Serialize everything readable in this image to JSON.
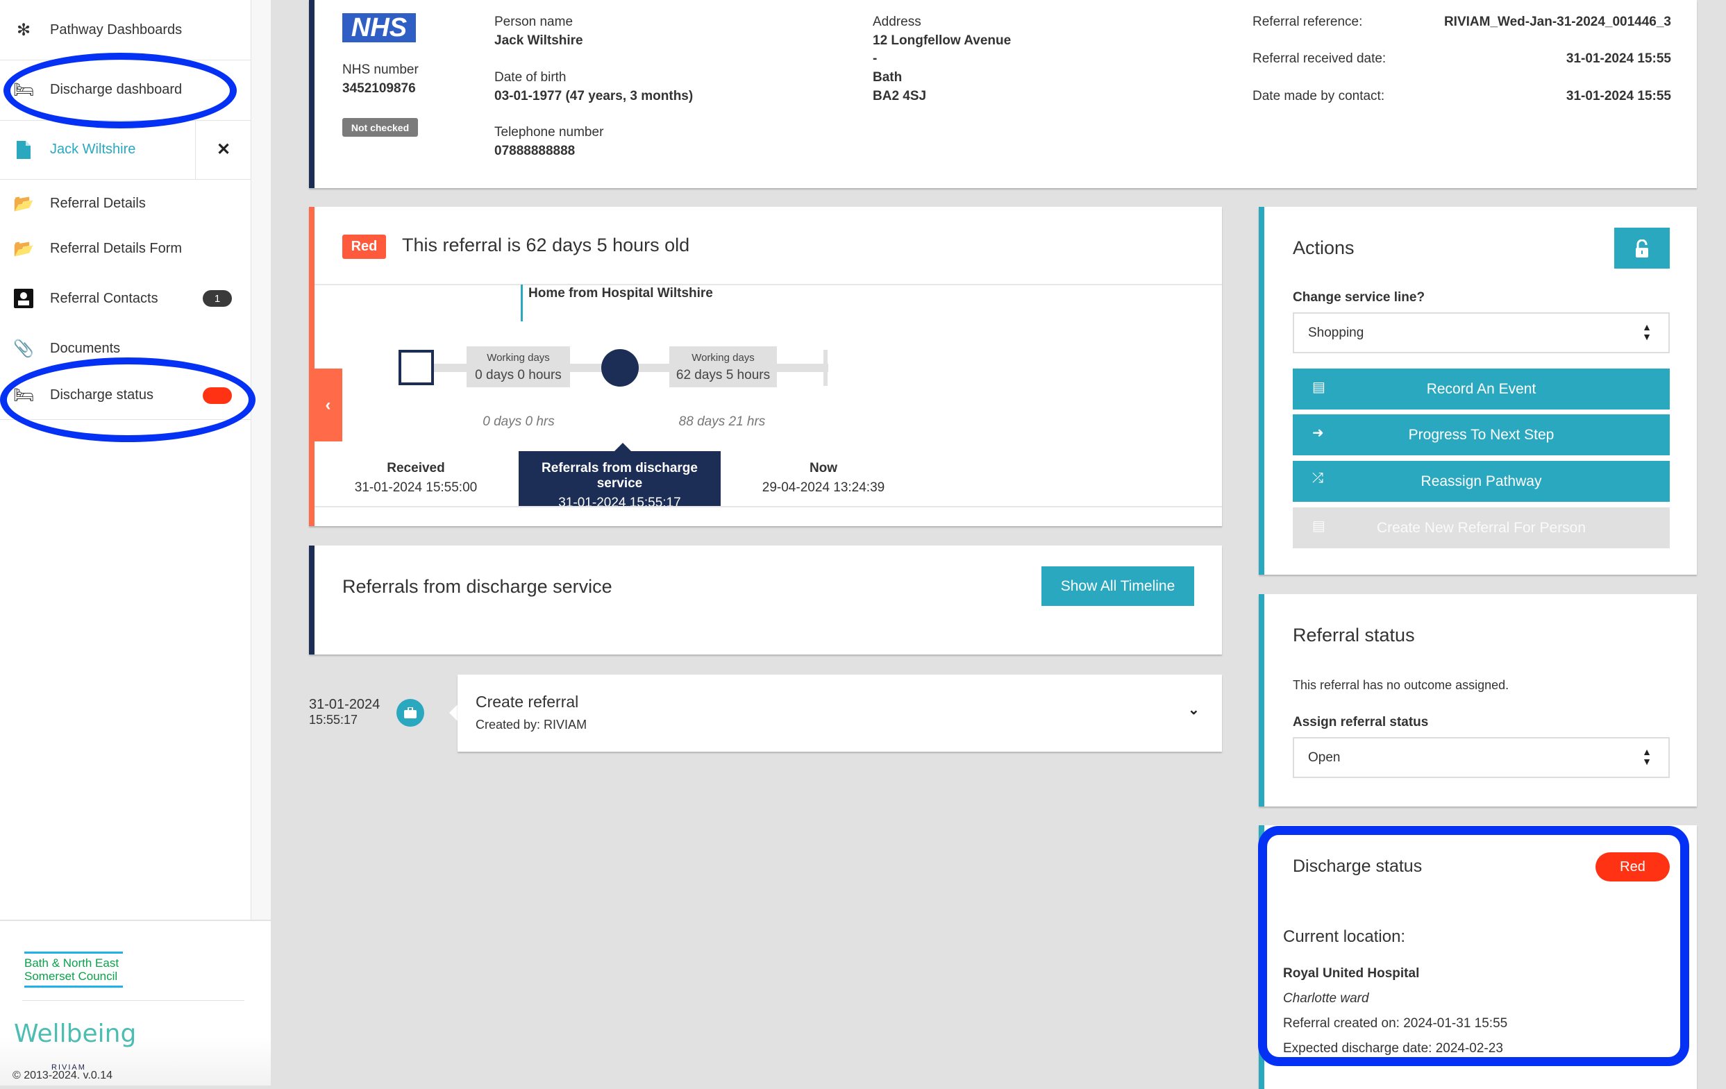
{
  "sidebar": {
    "items": [
      {
        "label": "Pathway Dashboards",
        "icon": "network-icon"
      },
      {
        "label": "Discharge dashboard",
        "icon": "bed-icon"
      },
      {
        "label": "Jack Wiltshire",
        "icon": "file-icon"
      },
      {
        "label": "Referral Details",
        "icon": "folder-open-icon"
      },
      {
        "label": "Referral Details Form",
        "icon": "folder-open-icon"
      },
      {
        "label": "Referral Contacts",
        "icon": "contact-icon",
        "badge": "1"
      },
      {
        "label": "Documents",
        "icon": "paperclip-icon"
      },
      {
        "label": "Discharge status",
        "icon": "bed-icon",
        "status_color": "#ff3314"
      }
    ],
    "close_label": "✕",
    "footer": {
      "council_logo": "Bath & North East Somerset Council",
      "wellbeing_logo": "Wellbeing",
      "riviam_logo": "RIVIAM",
      "copyright": "© 2013-2024. v.0.14"
    }
  },
  "person": {
    "nhs_logo": "NHS",
    "nhs_number_label": "NHS number",
    "nhs_number": "3452109876",
    "nhs_check": "Not checked",
    "name_label": "Person name",
    "name": "Jack Wiltshire",
    "dob_label": "Date of birth",
    "dob": "03-01-1977 (47 years, 3 months)",
    "tel_label": "Telephone number",
    "tel": "07888888888",
    "address_label": "Address",
    "address": [
      "12 Longfellow Avenue",
      "-",
      "Bath",
      "BA2 4SJ"
    ],
    "ref_label": "Referral reference:",
    "ref": "RIVIAM_Wed-Jan-31-2024_001446_3",
    "received_label": "Referral received date:",
    "received": "31-01-2024 15:55",
    "contact_label": "Date made by contact:",
    "contact": "31-01-2024 15:55"
  },
  "timeline": {
    "status_badge": "Red",
    "title": "This referral is 62 days 5 hours old",
    "service": "Home from Hospital Wiltshire",
    "seg1": {
      "label": "Working days",
      "value": "0 days 0 hours",
      "total": "0 days 0 hrs"
    },
    "seg2": {
      "label": "Working days",
      "value": "62 days 5 hours",
      "total": "88 days 21 hrs"
    },
    "received": {
      "label": "Received",
      "date": "31-01-2024 15:55:00"
    },
    "current": {
      "label": "Referrals from discharge service",
      "date": "31-01-2024 15:55:17"
    },
    "now": {
      "label": "Now",
      "date": "29-04-2024 13:24:39"
    },
    "accent": "#ff6a48"
  },
  "stage": {
    "title": "Referrals from discharge service",
    "button": "Show All Timeline"
  },
  "events": [
    {
      "date": "31-01-2024",
      "time": "15:55:17",
      "title": "Create referral",
      "by": "Created by: RIVIAM"
    }
  ],
  "actions": {
    "title": "Actions",
    "service_label": "Change service line?",
    "service_value": "Shopping",
    "buttons": [
      "Record An Event",
      "Progress To Next Step",
      "Reassign Pathway",
      "Create New Referral For Person"
    ],
    "accent": "#29a8bf"
  },
  "referral_status": {
    "title": "Referral status",
    "text": "This referral has no outcome assigned.",
    "assign_label": "Assign referral status",
    "value": "Open"
  },
  "discharge": {
    "title": "Discharge status",
    "badge": "Red",
    "location_label": "Current location:",
    "hospital": "Royal United Hospital",
    "ward": "Charlotte ward",
    "created": "Referral created on: 2024-01-31 15:55",
    "expected": "Expected discharge date: 2024-02-23"
  }
}
